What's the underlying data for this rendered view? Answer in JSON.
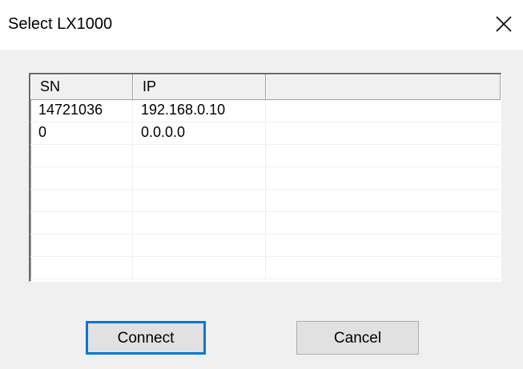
{
  "window": {
    "title": "Select LX1000"
  },
  "list": {
    "columns": [
      "SN",
      "IP",
      ""
    ],
    "rows": [
      [
        "14721036",
        "192.168.0.10",
        ""
      ],
      [
        "0",
        "0.0.0.0",
        ""
      ],
      [
        "",
        "",
        ""
      ],
      [
        "",
        "",
        ""
      ],
      [
        "",
        "",
        ""
      ],
      [
        "",
        "",
        ""
      ],
      [
        "",
        "",
        ""
      ],
      [
        "",
        "",
        ""
      ]
    ]
  },
  "buttons": {
    "connect_label": "Connect",
    "cancel_label": "Cancel"
  },
  "icons": {
    "close": "close-icon"
  },
  "colors": {
    "focus_border": "#0078d7",
    "dialog_bg": "#f0f0f0"
  }
}
